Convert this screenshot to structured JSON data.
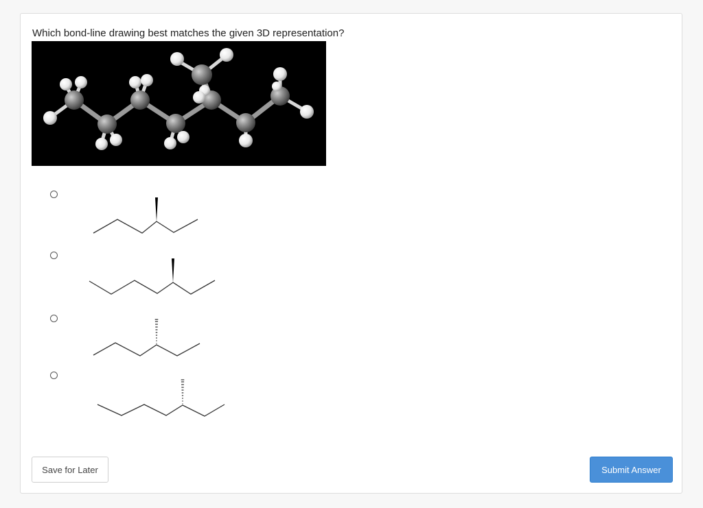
{
  "question": {
    "text": "Which bond-line drawing best matches the given 3D representation?"
  },
  "model_image": {
    "background": "#000000",
    "carbon_color": "#8a8a8a",
    "hydrogen_color": "#f2f2f2"
  },
  "options": [
    {
      "id": "option-1",
      "selected": false,
      "methyl_bond": "wedge"
    },
    {
      "id": "option-2",
      "selected": false,
      "methyl_bond": "wedge"
    },
    {
      "id": "option-3",
      "selected": false,
      "methyl_bond": "hash"
    },
    {
      "id": "option-4",
      "selected": false,
      "methyl_bond": "hash"
    }
  ],
  "buttons": {
    "save_label": "Save for Later",
    "submit_label": "Submit Answer"
  },
  "colors": {
    "accent": "#4a90d9",
    "text": "#222222",
    "line": "#333333"
  }
}
